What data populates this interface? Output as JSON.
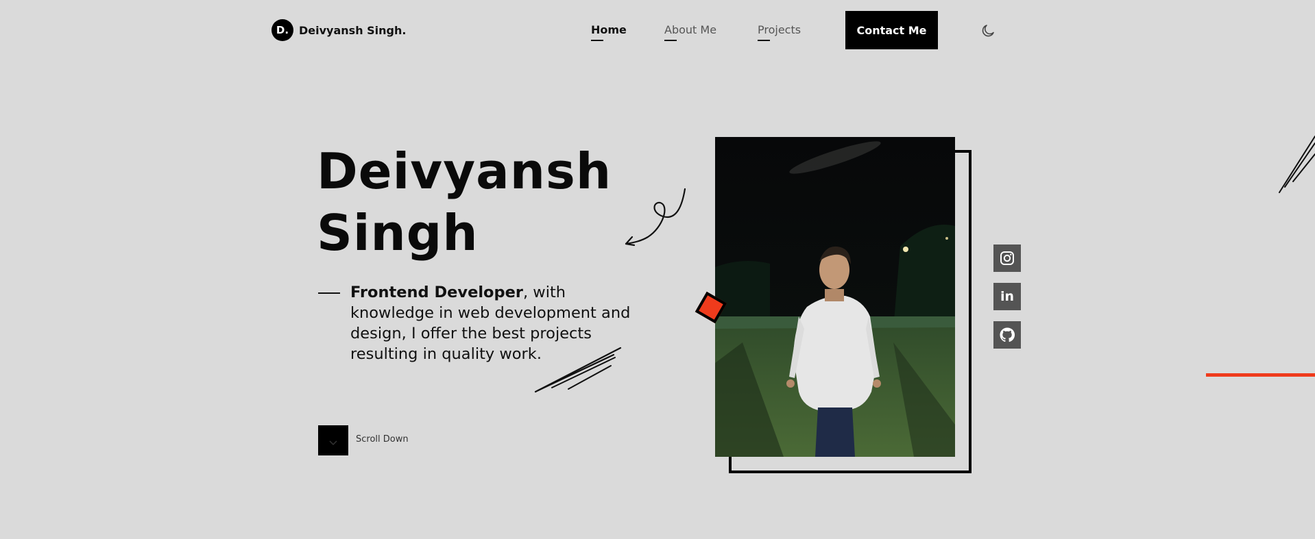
{
  "logo": {
    "initial": "D.",
    "name": "Deivyansh Singh."
  },
  "nav": {
    "items": [
      {
        "label": "Home",
        "active": true
      },
      {
        "label": "About Me",
        "active": false
      },
      {
        "label": "Projects",
        "active": false
      }
    ],
    "contact_label": "Contact Me",
    "theme_icon": "moon-icon"
  },
  "hero": {
    "title_line1": "Deivyansh",
    "title_line2": "Singh",
    "role": "Frontend Developer",
    "description": ", with knowledge in web development and design, I offer the best projects resulting in quality work.",
    "scroll_label": "Scroll Down"
  },
  "social": [
    {
      "icon": "instagram-icon"
    },
    {
      "icon": "linkedin-icon",
      "glyph": "in"
    },
    {
      "icon": "github-icon"
    }
  ],
  "colors": {
    "background": "#dadada",
    "accent": "#ef3b1c",
    "dark": "#000000",
    "social_bg": "#545454"
  }
}
